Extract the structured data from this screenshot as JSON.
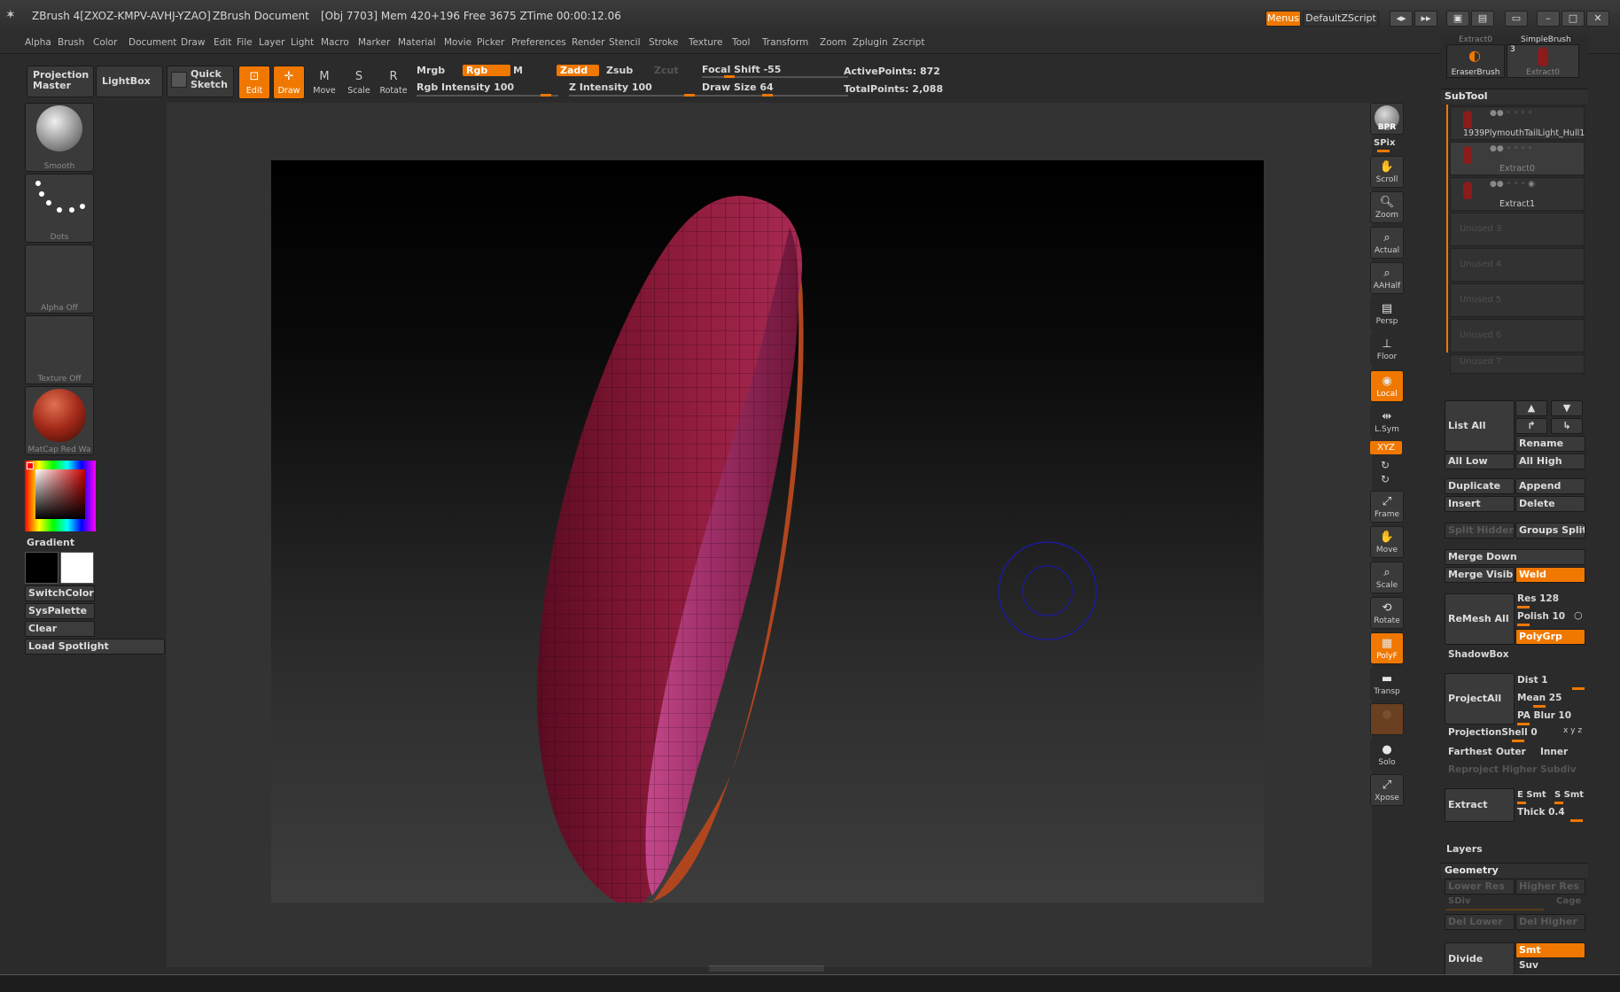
{
  "titlebar": {
    "app": "ZBrush 4[ZXOZ-KMPV-AVHJ-YZAO]",
    "doc": "ZBrush Document",
    "stats": "[Obj 7703]  Mem 420+196  Free 3675  ZTime 00:00:12.06",
    "menus_btn": "Menus",
    "script_btn": "DefaultZScript"
  },
  "menubar": [
    "Alpha",
    "Brush",
    "Color",
    "Document",
    "Draw",
    "Edit",
    "File",
    "Layer",
    "Light",
    "Macro",
    "Marker",
    "Material",
    "Movie",
    "Picker",
    "Preferences",
    "Render",
    "Stencil",
    "Stroke",
    "Texture",
    "Tool",
    "Transform",
    "Zoom",
    "Zplugin",
    "Zscript"
  ],
  "toolbar": {
    "projection_master": "Projection Master",
    "lightbox": "LightBox",
    "quick_sketch": "Quick Sketch",
    "edit": "Edit",
    "draw": "Draw",
    "move": "Move",
    "scale": "Scale",
    "rotate": "Rotate",
    "mrgb": "Mrgb",
    "rgb": "Rgb",
    "m": "M",
    "zadd": "Zadd",
    "zsub": "Zsub",
    "zcut": "Zcut",
    "rgb_intensity": "Rgb Intensity 100",
    "z_intensity": "Z Intensity 100",
    "focal_shift": "Focal Shift -55",
    "draw_size": "Draw Size 64",
    "active_points": "ActivePoints: 872",
    "total_points": "TotalPoints: 2,088"
  },
  "left": {
    "smooth": "Smooth",
    "dots": "Dots",
    "alpha_off": "Alpha  Off",
    "texture_off": "Texture  Off",
    "matcap": "MatCap  Red  Wa",
    "gradient": "Gradient",
    "switchcolor": "SwitchColor",
    "syspalette": "SysPalette",
    "clear": "Clear",
    "load_spotlight": "Load Spotlight"
  },
  "shelf": [
    "BPR",
    "SPix",
    "Scroll",
    "Zoom",
    "Actual",
    "AAHalf",
    "Persp",
    "Floor",
    "Local",
    "L.Sym",
    "XYZ",
    "Frame",
    "Move",
    "Scale",
    "Rotate",
    "PolyF",
    "Transp",
    "Ghost",
    "Solo",
    "Xpose"
  ],
  "right": {
    "top_brushes": [
      "Extract0",
      "SimpleBrush",
      "EraserBrush",
      "Extract0"
    ],
    "top_count": "3",
    "subtool_header": "SubTool",
    "subtools": [
      "1939PlymouthTailLight_Hull1",
      "Extract0",
      "Extract1",
      "Unused 3",
      "Unused 4",
      "Unused 5",
      "Unused 6",
      "Unused 7"
    ],
    "list_all": "List  All",
    "rename": "Rename",
    "all_low": "All Low",
    "all_high": "All High",
    "duplicate": "Duplicate",
    "append": "Append",
    "insert": "Insert",
    "delete": "Delete",
    "split_hidden": "Split  Hidden",
    "groups_split": "Groups  Split",
    "merge_down": "Merge  Down",
    "merge_visible": "Merge  Visible",
    "weld": "Weld",
    "remesh_all": "ReMesh  All",
    "res": "Res 128",
    "polish": "Polish 10",
    "polygrp": "PolyGrp",
    "shadowbox": "ShadowBox",
    "projectall": "ProjectAll",
    "dist": "Dist 1",
    "mean": "Mean 25",
    "pa_blur": "PA  Blur 10",
    "projectionshell": "ProjectionShell 0",
    "xyz_small": "x y z",
    "farthest": "Farthest",
    "outer": "Outer",
    "inner": "Inner",
    "reproject": "Reproject  Higher  Subdiv",
    "extract": "Extract",
    "e_smt": "E Smt",
    "s_smt": "S Smt",
    "thick": "Thick 0.4",
    "layers": "Layers",
    "geometry": "Geometry",
    "lower_res": "Lower Res",
    "higher_res": "Higher Res",
    "sdiv": "SDiv",
    "cage": "Cage",
    "del_lower": "Del Lower",
    "del_higher": "Del Higher",
    "divide": "Divide",
    "smt": "Smt",
    "suv": "Suv"
  },
  "colors": {
    "accent": "#f07800",
    "mesh_outer": "#8c1a3a",
    "mesh_inner": "#b5347a",
    "cursor": "#1a1aa0"
  }
}
